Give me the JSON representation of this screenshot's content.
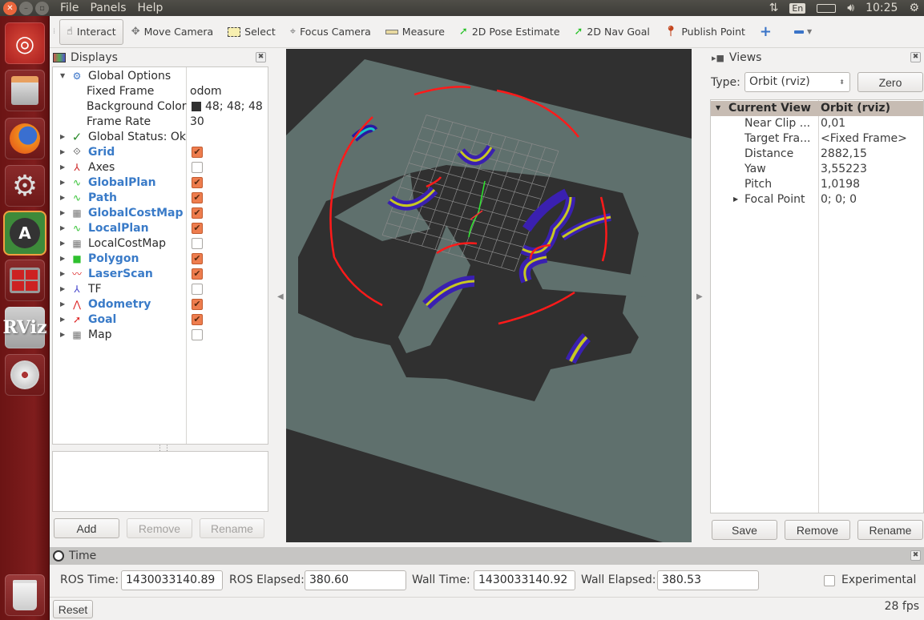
{
  "window": {
    "menu": [
      "File",
      "Panels",
      "Help"
    ],
    "tray": {
      "keyboard": "En",
      "clock": "10:25"
    }
  },
  "launcher": {
    "items": [
      "ubuntu-dash",
      "files",
      "firefox",
      "system-settings",
      "software-updater",
      "workspaces",
      "rviz",
      "dvd",
      "trash"
    ]
  },
  "toolbar": {
    "tools": [
      {
        "label": "Interact",
        "icon": "hand-icon",
        "active": true
      },
      {
        "label": "Move Camera",
        "icon": "move-camera-icon"
      },
      {
        "label": "Select",
        "icon": "select-icon"
      },
      {
        "label": "Focus Camera",
        "icon": "focus-camera-icon"
      },
      {
        "label": "Measure",
        "icon": "ruler-icon"
      },
      {
        "label": "2D Pose Estimate",
        "icon": "green-arrow-icon"
      },
      {
        "label": "2D Nav Goal",
        "icon": "green-arrow-icon"
      },
      {
        "label": "Publish Point",
        "icon": "map-pin-icon"
      }
    ]
  },
  "displays": {
    "title": "Displays",
    "global_options": {
      "label": "Global Options",
      "props": [
        {
          "name": "Fixed Frame",
          "value": "odom"
        },
        {
          "name": "Background Color",
          "value": "48; 48; 48",
          "swatch": "#303030"
        },
        {
          "name": "Frame Rate",
          "value": "30"
        }
      ]
    },
    "global_status": "Global Status: Ok",
    "items": [
      {
        "label": "Grid",
        "enabled": true
      },
      {
        "label": "Axes",
        "enabled": false
      },
      {
        "label": "GlobalPlan",
        "enabled": true
      },
      {
        "label": "Path",
        "enabled": true
      },
      {
        "label": "GlobalCostMap",
        "enabled": true
      },
      {
        "label": "LocalPlan",
        "enabled": true
      },
      {
        "label": "LocalCostMap",
        "enabled": false
      },
      {
        "label": "Polygon",
        "enabled": true
      },
      {
        "label": "LaserScan",
        "enabled": true
      },
      {
        "label": "TF",
        "enabled": false
      },
      {
        "label": "Odometry",
        "enabled": true
      },
      {
        "label": "Goal",
        "enabled": true
      },
      {
        "label": "Map",
        "enabled": false
      }
    ],
    "buttons": {
      "add": "Add",
      "remove": "Remove",
      "rename": "Rename"
    }
  },
  "views": {
    "title": "Views",
    "type_label": "Type:",
    "type_value": "Orbit (rviz)",
    "zero": "Zero",
    "current_view": {
      "label": "Current View",
      "value": "Orbit (rviz)"
    },
    "props": [
      {
        "name": "Near Clip ...",
        "value": "0,01"
      },
      {
        "name": "Target Fra...",
        "value": "<Fixed Frame>"
      },
      {
        "name": "Distance",
        "value": "2882,15"
      },
      {
        "name": "Yaw",
        "value": "3,55223"
      },
      {
        "name": "Pitch",
        "value": "1,0198"
      },
      {
        "name": "Focal Point",
        "value": "0; 0; 0"
      }
    ],
    "buttons": {
      "save": "Save",
      "remove": "Remove",
      "rename": "Rename"
    }
  },
  "time": {
    "title": "Time",
    "ros_time_label": "ROS Time:",
    "ros_time": "1430033140.89",
    "ros_elapsed_label": "ROS Elapsed:",
    "ros_elapsed": "380.60",
    "wall_time_label": "Wall Time:",
    "wall_time": "1430033140.92",
    "wall_elapsed_label": "Wall Elapsed:",
    "wall_elapsed": "380.53",
    "experimental_label": "Experimental",
    "experimental": false,
    "reset": "Reset",
    "fps": "28 fps"
  },
  "colors": {
    "background": "#303030",
    "map_free": "#5f706d",
    "laser": "#ff1a1a",
    "path": "#2ee82e",
    "checkbox_on": "#ee7d4e",
    "display_blue": "#3a7bc8"
  }
}
